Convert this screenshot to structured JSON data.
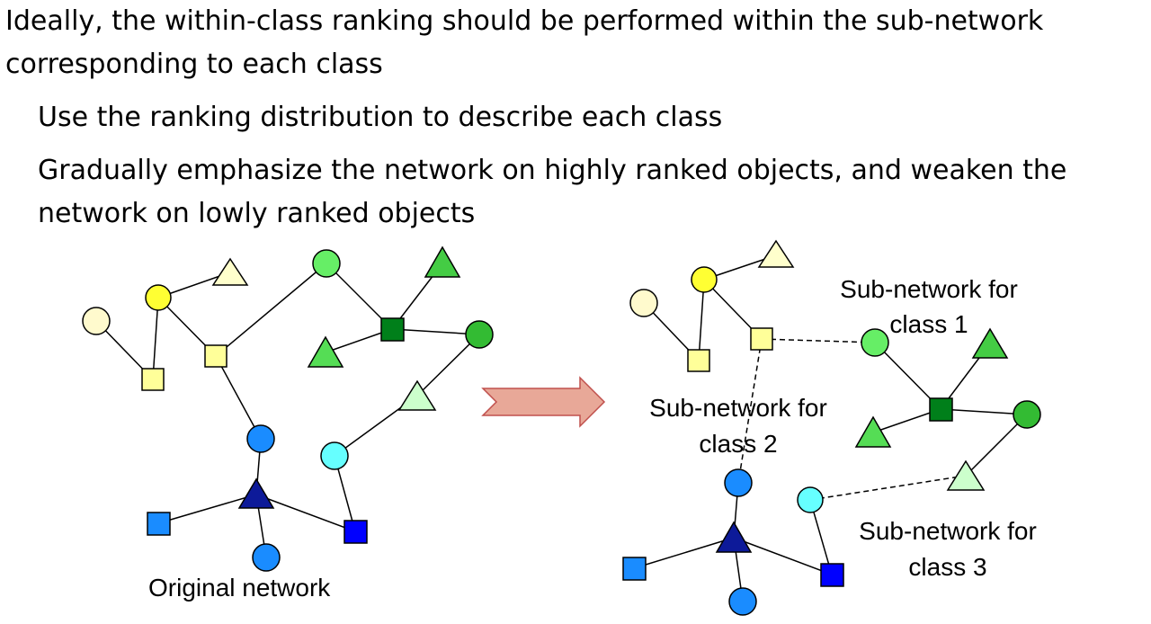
{
  "slide": {
    "bullets": [
      {
        "line1": "Ideally, the within-class ranking should be performed within the sub-network",
        "line2": "corresponding to each class"
      },
      {
        "text": "Use the ranking distribution to describe each class"
      },
      {
        "line1": "Gradually emphasize the network on highly ranked objects, and weaken the",
        "line2": "network on lowly ranked objects"
      }
    ]
  },
  "diagram": {
    "left_caption": "Original network",
    "labels": {
      "class1_line1": "Sub-network for",
      "class1_line2": "class 1",
      "class2_line1": "Sub-network for",
      "class2_line2": "class 2",
      "class3_line1": "Sub-network for",
      "class3_line2": "class 3"
    },
    "colors": {
      "pale_yellow": "#fffacd",
      "yellow": "#ffff33",
      "light_yellow_square": "#ffff99",
      "light_green": "#66ee66",
      "green": "#44cc44",
      "dark_green": "#007f1a",
      "pale_green": "#ccffcc",
      "cyan": "#66ffff",
      "blue": "#1a8cff",
      "dark_blue": "#0d1a99",
      "square_blue": "#0000ff",
      "arrow_fill": "#e8a898",
      "arrow_stroke": "#c0504d"
    }
  }
}
